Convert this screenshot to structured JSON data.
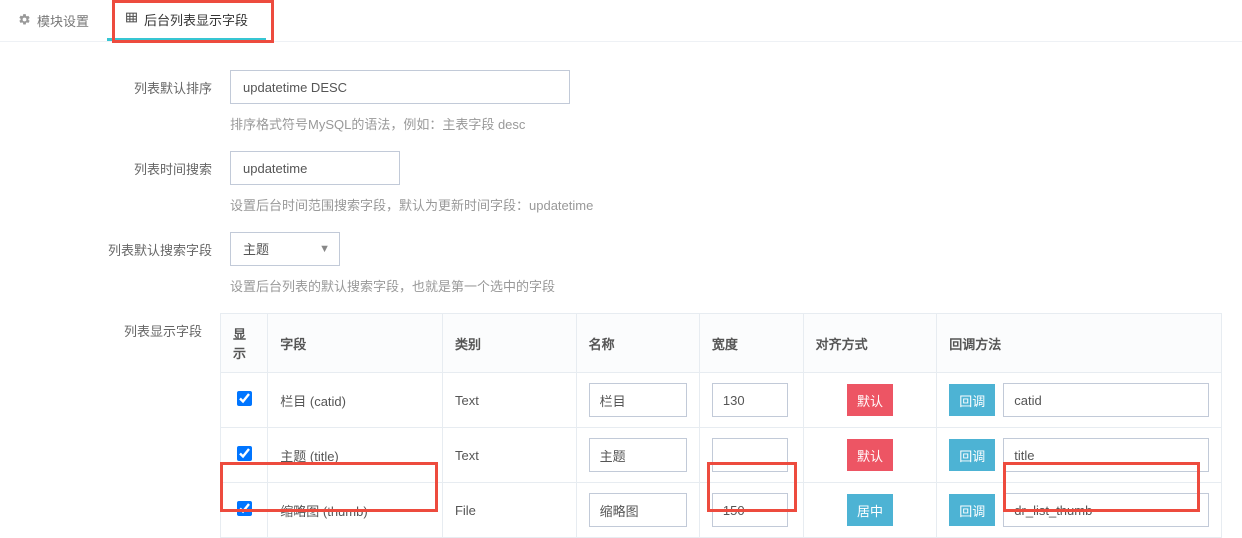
{
  "tabs": {
    "module_settings": "模块设置",
    "list_fields": "后台列表显示字段"
  },
  "form": {
    "default_sort": {
      "label": "列表默认排序",
      "value": "updatetime DESC",
      "help": "排序格式符号MySQL的语法，例如：主表字段 desc"
    },
    "time_search": {
      "label": "列表时间搜索",
      "value": "updatetime",
      "help": "设置后台时间范围搜索字段，默认为更新时间字段：updatetime"
    },
    "default_search": {
      "label": "列表默认搜索字段",
      "value": "主题",
      "help": "设置后台列表的默认搜索字段，也就是第一个选中的字段"
    },
    "display_fields_label": "列表显示字段"
  },
  "table": {
    "headers": {
      "show": "显示",
      "field": "字段",
      "type": "类别",
      "name": "名称",
      "width": "宽度",
      "align": "对齐方式",
      "callback": "回调方法"
    },
    "rows": [
      {
        "checked": true,
        "field": "栏目 (catid)",
        "type": "Text",
        "name": "栏目",
        "width": "130",
        "align_label": "默认",
        "align_style": "red",
        "cb": "catid"
      },
      {
        "checked": true,
        "field": "主题 (title)",
        "type": "Text",
        "name": "主题",
        "width": "",
        "align_label": "默认",
        "align_style": "red",
        "cb": "title"
      },
      {
        "checked": true,
        "field": "缩略图 (thumb)",
        "type": "File",
        "name": "缩略图",
        "width": "150",
        "align_label": "居中",
        "align_style": "blue",
        "cb": "dr_list_thumb"
      }
    ],
    "callback_btn": "回调"
  }
}
